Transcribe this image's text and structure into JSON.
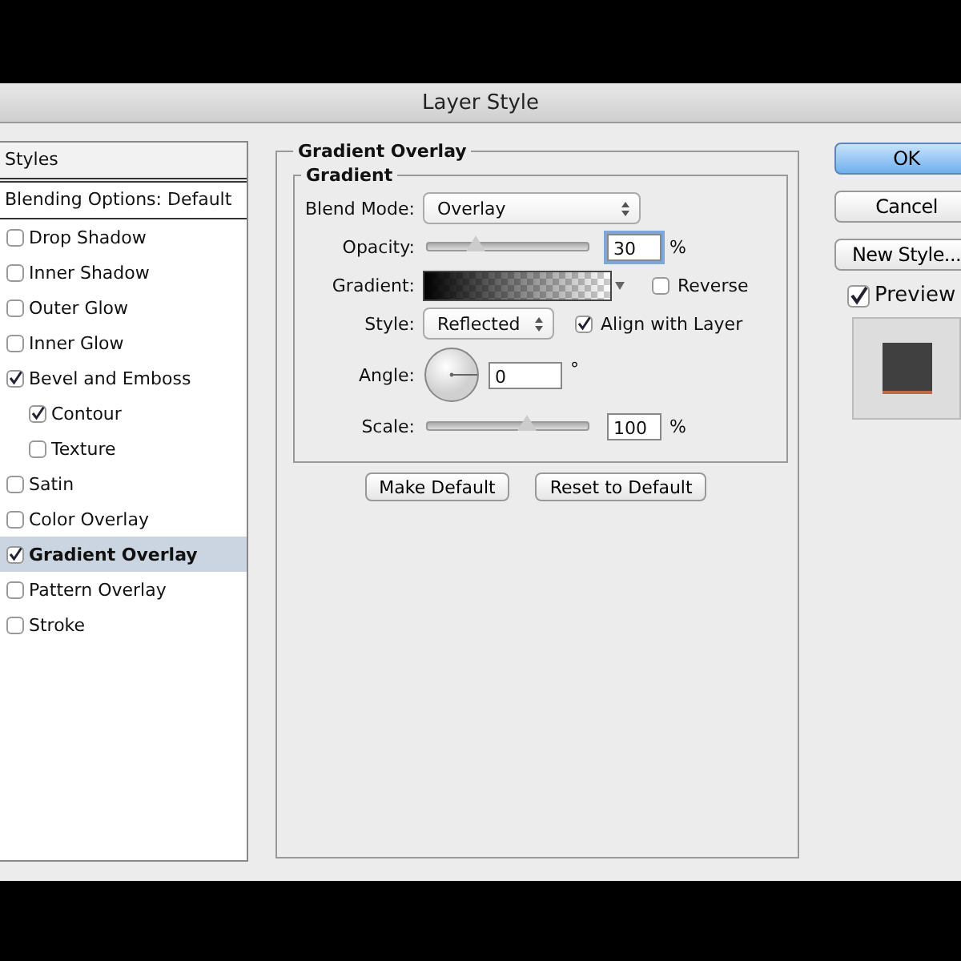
{
  "window": {
    "title": "Layer Style"
  },
  "styles_panel": {
    "header": "Styles",
    "items": [
      {
        "label": "Blending Options: Default",
        "kind": "plain",
        "selected": false
      },
      {
        "label": "Drop Shadow",
        "kind": "check",
        "checked": false,
        "selected": false
      },
      {
        "label": "Inner Shadow",
        "kind": "check",
        "checked": false,
        "selected": false
      },
      {
        "label": "Outer Glow",
        "kind": "check",
        "checked": false,
        "selected": false
      },
      {
        "label": "Inner Glow",
        "kind": "check",
        "checked": false,
        "selected": false
      },
      {
        "label": "Bevel and Emboss",
        "kind": "check",
        "checked": true,
        "selected": false,
        "children": [
          {
            "label": "Contour",
            "kind": "check",
            "checked": true,
            "selected": false
          },
          {
            "label": "Texture",
            "kind": "check",
            "checked": false,
            "selected": false
          }
        ]
      },
      {
        "label": "Satin",
        "kind": "check",
        "checked": false,
        "selected": false
      },
      {
        "label": "Color Overlay",
        "kind": "check",
        "checked": false,
        "selected": false
      },
      {
        "label": "Gradient Overlay",
        "kind": "check",
        "checked": true,
        "selected": true
      },
      {
        "label": "Pattern Overlay",
        "kind": "check",
        "checked": false,
        "selected": false
      },
      {
        "label": "Stroke",
        "kind": "check",
        "checked": false,
        "selected": false
      }
    ]
  },
  "settings": {
    "title": "Gradient Overlay",
    "group": "Gradient",
    "blend_mode": {
      "label": "Blend Mode:",
      "value": "Overlay"
    },
    "opacity": {
      "label": "Opacity:",
      "level": 0.3,
      "value": "30",
      "unit": "%"
    },
    "gradient": {
      "label": "Gradient:"
    },
    "reverse": {
      "label": "Reverse",
      "checked": false
    },
    "style": {
      "label": "Style:",
      "value": "Reflected"
    },
    "align_with_layer": {
      "label": "Align with Layer",
      "checked": true
    },
    "angle": {
      "label": "Angle:",
      "value": "0",
      "unit": "°"
    },
    "scale": {
      "label": "Scale:",
      "level": 0.62,
      "value": "100",
      "unit": "%"
    },
    "buttons": [
      "Make Default",
      "Reset to Default"
    ]
  },
  "actions": {
    "ok": "OK",
    "cancel": "Cancel",
    "new_style": "New Style...",
    "preview": {
      "label": "Preview",
      "checked": true
    }
  }
}
